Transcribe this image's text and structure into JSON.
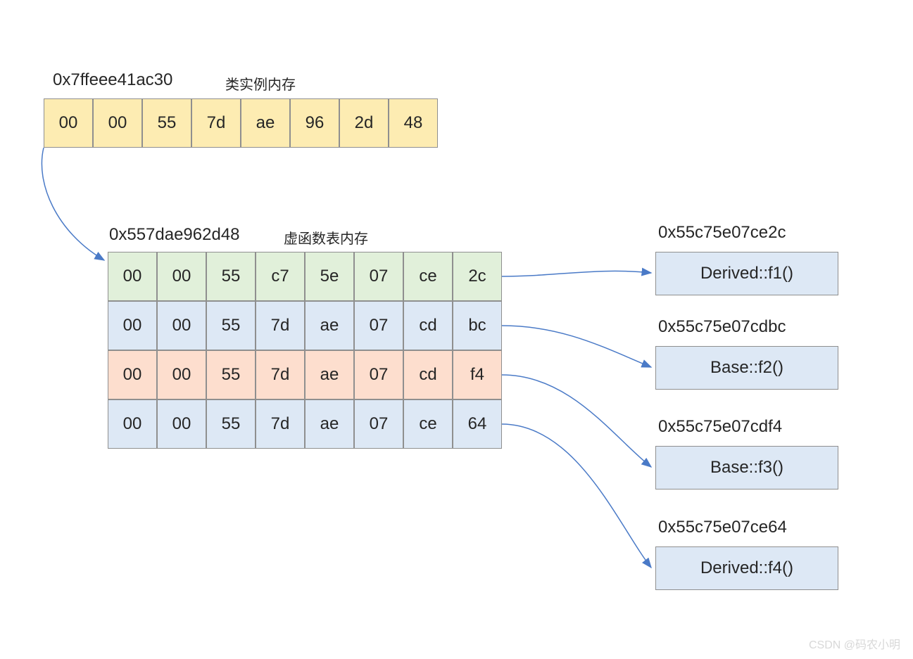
{
  "instance": {
    "address": "0x7ffeee41ac30",
    "label": "类实例内存",
    "bytes": [
      "00",
      "00",
      "55",
      "7d",
      "ae",
      "96",
      "2d",
      "48"
    ]
  },
  "vtable": {
    "address": "0x557dae962d48",
    "label": "虚函数表内存",
    "rows": [
      {
        "color": "green",
        "bytes": [
          "00",
          "00",
          "55",
          "c7",
          "5e",
          "07",
          "ce",
          "2c"
        ]
      },
      {
        "color": "blue",
        "bytes": [
          "00",
          "00",
          "55",
          "7d",
          "ae",
          "07",
          "cd",
          "bc"
        ]
      },
      {
        "color": "pink",
        "bytes": [
          "00",
          "00",
          "55",
          "7d",
          "ae",
          "07",
          "cd",
          "f4"
        ]
      },
      {
        "color": "grey",
        "bytes": [
          "00",
          "00",
          "55",
          "7d",
          "ae",
          "07",
          "ce",
          "64"
        ]
      }
    ]
  },
  "functions": [
    {
      "address": "0x55c75e07ce2c",
      "name": "Derived::f1()"
    },
    {
      "address": "0x55c75e07cdbc",
      "name": "Base::f2()"
    },
    {
      "address": "0x55c75e07cdf4",
      "name": "Base::f3()"
    },
    {
      "address": "0x55c75e07ce64",
      "name": "Derived::f4()"
    }
  ],
  "watermark": "CSDN @码农小明"
}
